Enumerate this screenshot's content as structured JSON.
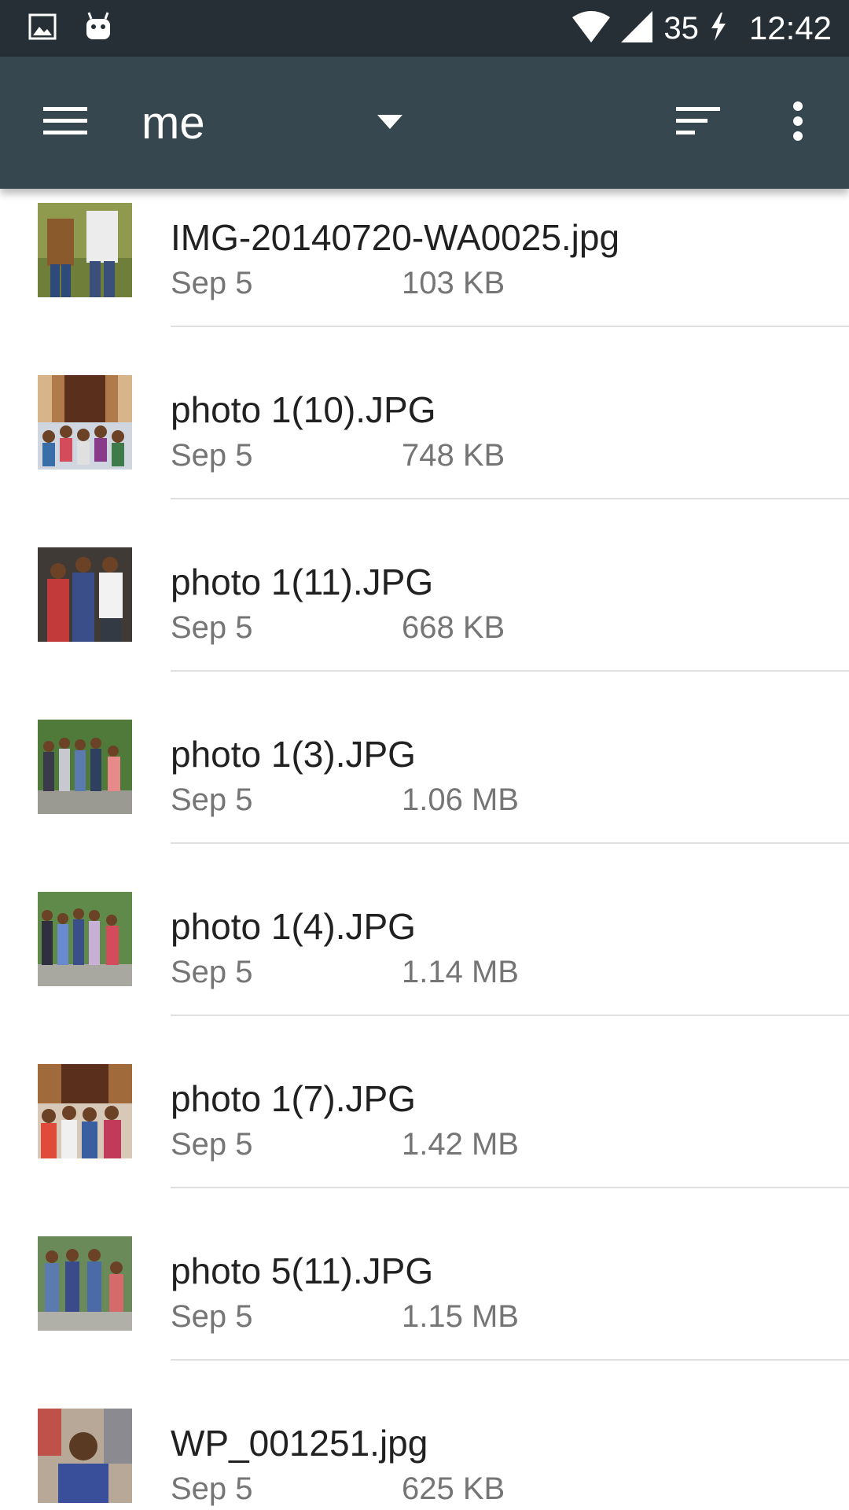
{
  "status_bar": {
    "battery_level": "35",
    "time": "12:42",
    "icons": [
      "gallery-notification-icon",
      "android-icon",
      "wifi-icon",
      "cell-signal-icon",
      "charging-bolt-icon"
    ]
  },
  "toolbar": {
    "title": "me",
    "icons": [
      "hamburger-menu-icon",
      "dropdown-arrow-icon",
      "sort-icon",
      "overflow-menu-icon"
    ],
    "background_color": "#37474f"
  },
  "files": [
    {
      "name": "IMG-20140720-WA0025.jpg",
      "date": "Sep 5",
      "size": "103 KB"
    },
    {
      "name": "photo 1(10).JPG",
      "date": "Sep 5",
      "size": "748 KB"
    },
    {
      "name": "photo 1(11).JPG",
      "date": "Sep 5",
      "size": "668 KB"
    },
    {
      "name": "photo 1(3).JPG",
      "date": "Sep 5",
      "size": "1.06 MB"
    },
    {
      "name": "photo 1(4).JPG",
      "date": "Sep 5",
      "size": "1.14 MB"
    },
    {
      "name": "photo 1(7).JPG",
      "date": "Sep 5",
      "size": "1.42 MB"
    },
    {
      "name": "photo 5(11).JPG",
      "date": "Sep 5",
      "size": "1.15 MB"
    },
    {
      "name": "WP_001251.jpg",
      "date": "Sep 5",
      "size": "625 KB"
    }
  ]
}
